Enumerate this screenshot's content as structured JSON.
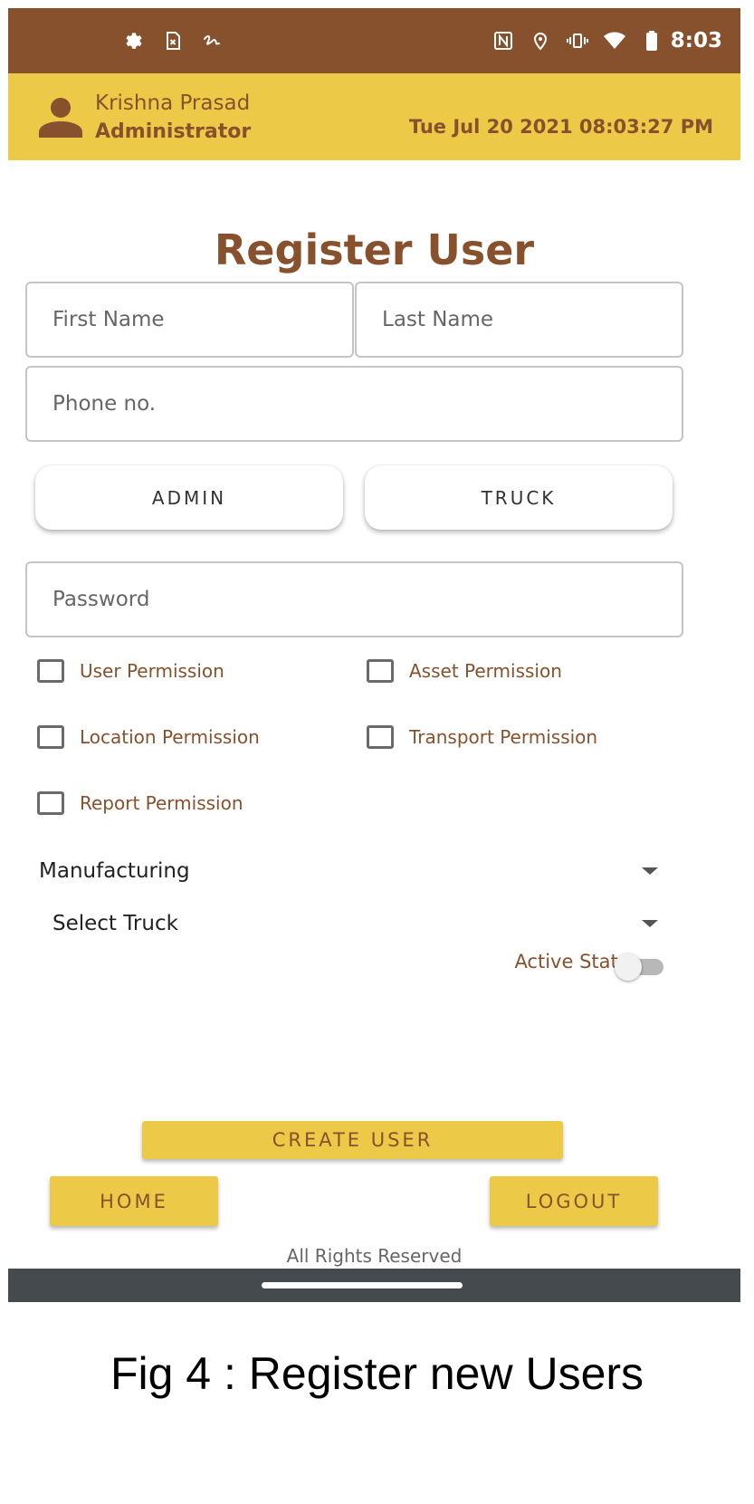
{
  "status_bar": {
    "time": "8:03",
    "left_icons": [
      "settings-icon",
      "sim-card-icon",
      "signature-icon"
    ],
    "right_icons": [
      "nfc-icon",
      "location-icon",
      "vibrate-icon",
      "wifi-icon",
      "battery-icon"
    ]
  },
  "header": {
    "user_name": "Krishna Prasad",
    "user_role": "Administrator",
    "datetime": "Tue Jul 20 2021 08:03:27 PM"
  },
  "form": {
    "title": "Register User",
    "first_name_placeholder": "First Name",
    "last_name_placeholder": "Last Name",
    "phone_placeholder": "Phone no.",
    "role_buttons": [
      "ADMIN",
      "TRUCK"
    ],
    "password_placeholder": "Password",
    "permissions": [
      {
        "label": "User Permission",
        "checked": false
      },
      {
        "label": "Asset Permission",
        "checked": false
      },
      {
        "label": "Location Permission",
        "checked": false
      },
      {
        "label": "Transport Permission",
        "checked": false
      },
      {
        "label": "Report Permission",
        "checked": false
      }
    ],
    "department_selected": "Manufacturing",
    "truck_selected": "Select Truck",
    "active_status_label": "Active Status",
    "active_status_on": false
  },
  "actions": {
    "create_user": "CREATE USER",
    "home": "HOME",
    "logout": "LOGOUT"
  },
  "footer": {
    "rights": "All Rights Reserved"
  },
  "caption": "Fig 4 : Register new Users",
  "colors": {
    "brown": "#87512d",
    "yellow": "#ecc946",
    "nav_bar": "#454a4f"
  }
}
